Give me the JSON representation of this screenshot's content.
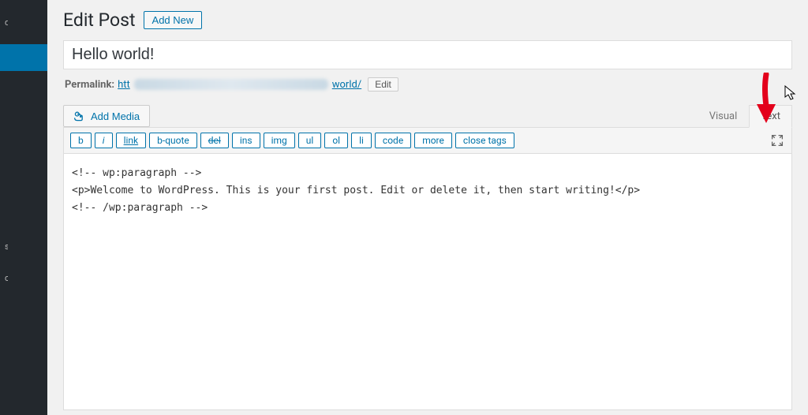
{
  "sidebar": {
    "items": [
      "d",
      "s",
      "ce"
    ]
  },
  "header": {
    "page_title": "Edit Post",
    "add_new_label": "Add New"
  },
  "post": {
    "title": "Hello world!",
    "permalink_label": "Permalink:",
    "permalink_prefix": "htt",
    "permalink_suffix": "world/",
    "permalink_edit_label": "Edit"
  },
  "media": {
    "add_media_label": "Add Media"
  },
  "tabs": {
    "visual_label": "Visual",
    "text_label": "Text"
  },
  "quicktags": {
    "b": "b",
    "i": "i",
    "link": "link",
    "bquote": "b-quote",
    "del": "del",
    "ins": "ins",
    "img": "img",
    "ul": "ul",
    "ol": "ol",
    "li": "li",
    "code": "code",
    "more": "more",
    "close": "close tags"
  },
  "content": "<!-- wp:paragraph -->\n<p>Welcome to WordPress. This is your first post. Edit or delete it, then start writing!</p>\n<!-- /wp:paragraph -->"
}
